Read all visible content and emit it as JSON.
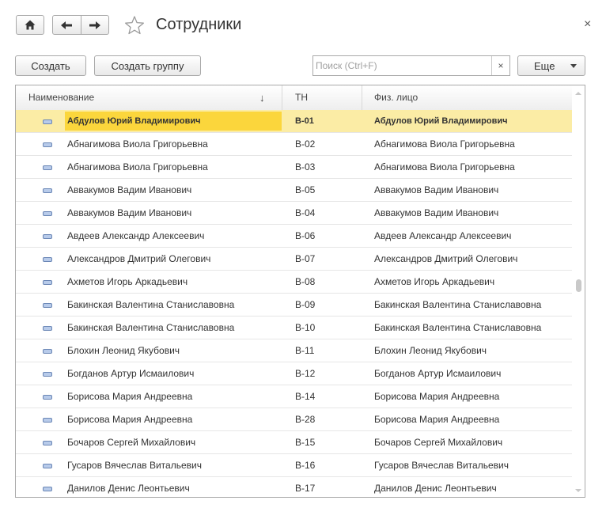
{
  "window": {
    "title": "Сотрудники",
    "close_glyph": "×"
  },
  "toolbar": {
    "create_label": "Создать",
    "create_group_label": "Создать группу",
    "search_placeholder": "Поиск (Ctrl+F)",
    "search_value": "",
    "search_clear_glyph": "×",
    "more_label": "Еще"
  },
  "icons": {
    "home": "home-icon",
    "back": "arrow-left-icon",
    "forward": "arrow-right-icon",
    "favorite": "star-icon",
    "row_item": "element-icon",
    "sort": "sort-arrow-down-icon",
    "more_dropdown": "caret-down-icon"
  },
  "colors": {
    "selected_row": "#fbeca5",
    "selected_cell": "#fbd63c",
    "border": "#a9a9a9"
  },
  "table": {
    "columns": [
      "Наименование",
      "ТН",
      "Физ. лицо"
    ],
    "sort_glyph": "↓",
    "selected_index": 0,
    "scroll_position": 0.49,
    "rows": [
      {
        "name": "Абдулов Юрий Владимирович",
        "tn": "В-01",
        "person": "Абдулов Юрий Владимирович"
      },
      {
        "name": "Абнагимова Виола Григорьевна",
        "tn": "В-02",
        "person": "Абнагимова Виола Григорьевна"
      },
      {
        "name": "Абнагимова Виола Григорьевна",
        "tn": "В-03",
        "person": "Абнагимова Виола Григорьевна"
      },
      {
        "name": "Аввакумов Вадим Иванович",
        "tn": "В-05",
        "person": "Аввакумов Вадим Иванович"
      },
      {
        "name": "Аввакумов Вадим Иванович",
        "tn": "В-04",
        "person": "Аввакумов Вадим Иванович"
      },
      {
        "name": "Авдеев Александр Алексеевич",
        "tn": "В-06",
        "person": "Авдеев Александр Алексеевич"
      },
      {
        "name": "Александров Дмитрий Олегович",
        "tn": "В-07",
        "person": "Александров Дмитрий Олегович"
      },
      {
        "name": "Ахметов Игорь Аркадьевич",
        "tn": "В-08",
        "person": "Ахметов Игорь Аркадьевич"
      },
      {
        "name": "Бакинская Валентина Станиславовна",
        "tn": "В-09",
        "person": "Бакинская Валентина Станиславовна"
      },
      {
        "name": "Бакинская Валентина Станиславовна",
        "tn": "В-10",
        "person": "Бакинская Валентина Станиславовна"
      },
      {
        "name": "Блохин Леонид Якубович",
        "tn": "В-11",
        "person": "Блохин Леонид Якубович"
      },
      {
        "name": "Богданов Артур Исмаилович",
        "tn": "В-12",
        "person": "Богданов Артур Исмаилович"
      },
      {
        "name": "Борисова Мария Андреевна",
        "tn": "В-14",
        "person": "Борисова Мария Андреевна"
      },
      {
        "name": "Борисова Мария Андреевна",
        "tn": "В-28",
        "person": "Борисова Мария Андреевна"
      },
      {
        "name": "Бочаров Сергей Михайлович",
        "tn": "В-15",
        "person": "Бочаров Сергей Михайлович"
      },
      {
        "name": "Гусаров Вячеслав Витальевич",
        "tn": "В-16",
        "person": "Гусаров Вячеслав Витальевич"
      },
      {
        "name": "Данилов Денис Леонтьевич",
        "tn": "В-17",
        "person": "Данилов Денис Леонтьевич"
      }
    ]
  }
}
